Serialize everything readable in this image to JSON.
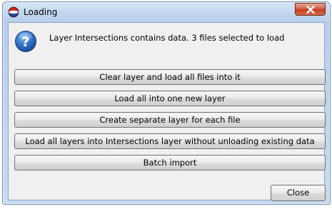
{
  "window": {
    "title": "Loading",
    "title_icon": "app-icon",
    "close_icon": "close-icon"
  },
  "dialog": {
    "icon": "question-icon",
    "message": "Layer Intersections contains data. 3 files selected to load"
  },
  "options": [
    "Clear layer and load all files into it",
    "Load all into one new layer",
    "Create separate layer for each file",
    "Load all layers into Intersections layer without unloading existing data",
    "Batch import"
  ],
  "footer": {
    "close_label": "Close"
  }
}
